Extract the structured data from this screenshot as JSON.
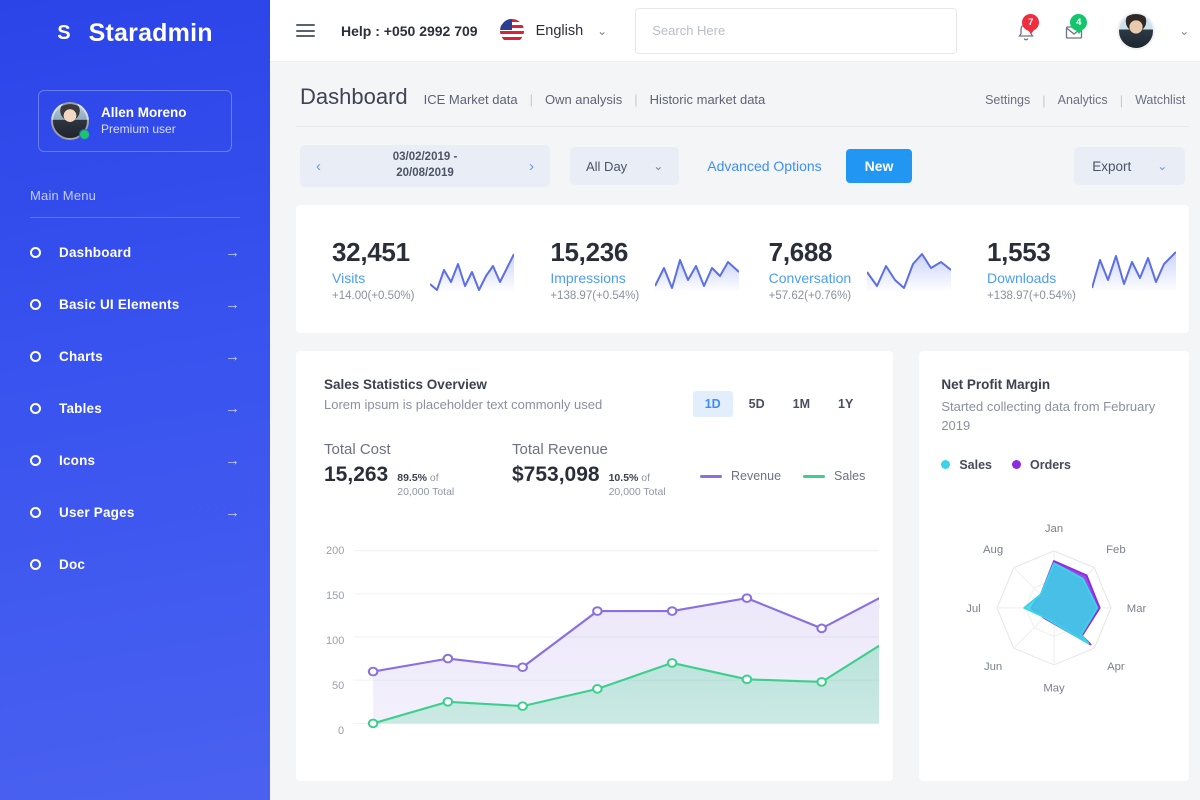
{
  "sidebar": {
    "brand_mark": "S",
    "brand_name": "Staradmin",
    "profile": {
      "name": "Allen Moreno",
      "role": "Premium user",
      "avatar_icon": "user-avatar"
    },
    "menu_label": "Main Menu",
    "items": [
      {
        "label": "Dashboard",
        "icon": "circle-bullet-icon",
        "arrow": "→"
      },
      {
        "label": "Basic UI Elements",
        "icon": "circle-bullet-icon",
        "arrow": "→"
      },
      {
        "label": "Charts",
        "icon": "circle-bullet-icon",
        "arrow": "→"
      },
      {
        "label": "Tables",
        "icon": "circle-bullet-icon",
        "arrow": "→"
      },
      {
        "label": "Icons",
        "icon": "circle-bullet-icon",
        "arrow": "→"
      },
      {
        "label": "User Pages",
        "icon": "circle-bullet-icon",
        "arrow": "→"
      },
      {
        "label": "Doc",
        "icon": "circle-bullet-icon",
        "arrow": ""
      }
    ]
  },
  "topbar": {
    "menu_icon": "hamburger-icon",
    "help": "Help : +050 2992 709",
    "flag_icon": "us-flag-icon",
    "language": "English",
    "language_caret": "⌄",
    "search": {
      "placeholder": "Search Here",
      "value": ""
    },
    "notifications": {
      "icon": "bell-icon",
      "count": "7",
      "color": "#f02c3d"
    },
    "messages": {
      "icon": "envelope-icon",
      "count": "4",
      "color": "#13c56b"
    },
    "user_caret": "⌄"
  },
  "page": {
    "title": "Dashboard",
    "subnav": [
      "ICE Market data",
      "Own analysis",
      "Historic market data"
    ],
    "separator": "|",
    "right_links": [
      "Settings",
      "Analytics",
      "Watchlist"
    ]
  },
  "toolbar": {
    "prev_icon": "chevron-left-icon",
    "next_icon": "chevron-right-icon",
    "date_from": "03/02/2019 -",
    "date_to": "20/08/2019",
    "all_day": "All Day",
    "all_day_caret": "⌄",
    "advanced_options": "Advanced Options",
    "new_button": "New",
    "export": "Export",
    "export_caret": "⌄"
  },
  "stats": [
    {
      "value": "32,451",
      "label": "Visits",
      "delta": "+14.00(+0.50%)",
      "spark": [
        14,
        4,
        20,
        8,
        26,
        6,
        18,
        2,
        14,
        24,
        10,
        30
      ]
    },
    {
      "value": "15,236",
      "label": "Impressions",
      "delta": "+138.97(+0.54%)",
      "spark": [
        10,
        22,
        6,
        26,
        12,
        20,
        8,
        18,
        14,
        24,
        16,
        28
      ]
    },
    {
      "value": "7,688",
      "label": "Conversation",
      "delta": "+57.62(+0.76%)",
      "spark": [
        20,
        6,
        24,
        10,
        16,
        4,
        28,
        12,
        22,
        8,
        26,
        18
      ]
    },
    {
      "value": "1,553",
      "label": "Downloads",
      "delta": "+138.97(+0.54%)",
      "spark": [
        8,
        26,
        12,
        22,
        6,
        28,
        14,
        20,
        10,
        24,
        16,
        30
      ]
    }
  ],
  "sales_card": {
    "title": "Sales Statistics Overview",
    "description": "Lorem ipsum is placeholder text commonly used",
    "ranges": [
      "1D",
      "5D",
      "1M",
      "1Y"
    ],
    "active_range": "1D",
    "total_cost": {
      "label": "Total Cost",
      "value": "15,263",
      "pct": "89.5%",
      "of": " of",
      "total": "20,000 Total"
    },
    "total_revenue": {
      "label": "Total Revenue",
      "value": "$753,098",
      "pct": "10.5%",
      "of": " of",
      "total": "20,000 Total"
    },
    "legend": [
      {
        "name": "Revenue",
        "color": "#8a6fe0"
      },
      {
        "name": "Sales",
        "color": "#3ecf8e"
      }
    ]
  },
  "profit_card": {
    "title": "Net Profit Margin",
    "subtitle": "Started collecting data from February 2019",
    "legend": [
      {
        "name": "Sales",
        "color": "#3ad3e8"
      },
      {
        "name": "Orders",
        "color": "#8b2ce0"
      }
    ]
  },
  "chart_data": [
    {
      "type": "area",
      "title": "Sales Statistics Overview",
      "xlabel": "",
      "ylabel": "",
      "ylim": [
        0,
        200
      ],
      "yticks": [
        0,
        50,
        100,
        150,
        200
      ],
      "grid": true,
      "legend_position": "top",
      "x": [
        1,
        2,
        3,
        4,
        5,
        6,
        7,
        8
      ],
      "series": [
        {
          "name": "Revenue",
          "color": "#8a6fe0",
          "values": [
            60,
            75,
            65,
            130,
            130,
            145,
            110,
            145
          ]
        },
        {
          "name": "Sales",
          "color": "#3ecf8e",
          "values": [
            0,
            25,
            20,
            40,
            70,
            51,
            48,
            90
          ]
        }
      ]
    },
    {
      "type": "radar",
      "title": "Net Profit Margin",
      "categories": [
        "Jan",
        "Feb",
        "Mar",
        "Apr",
        "May",
        "Jun",
        "Jul",
        "Aug"
      ],
      "max": 100,
      "series": [
        {
          "name": "Sales",
          "color": "#3ad3e8",
          "values": [
            78,
            72,
            76,
            68,
            62,
            38,
            52,
            30
          ]
        },
        {
          "name": "Orders",
          "color": "#8b2ce0",
          "values": [
            82,
            86,
            80,
            70,
            64,
            40,
            40,
            30
          ]
        }
      ]
    }
  ]
}
